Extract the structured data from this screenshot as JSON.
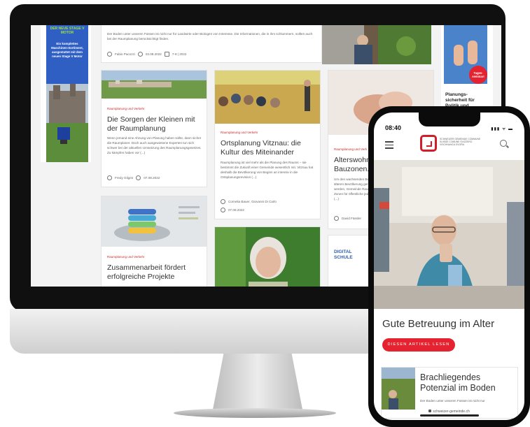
{
  "desktop": {
    "top_article": {
      "text": "Der Boden unter unseren Füssen ist nicht nur für Landwirte oder Biologen von Interesse. Die Informationen, die in ihm schlummern, sollten auch bei der Raumplanung berücksichtigt finden.",
      "author": "Fabio Pacozzi",
      "date": "03.08.2022",
      "issue": "7-8 | 2022"
    },
    "ad_left": {
      "headline": "DER NEUE STAGE V MOTOR",
      "text": "Ein komplettes Maschinen-Sortiment, ausgestattet mit dem neuen Stage V Motor"
    },
    "ad_right": {
      "badge": "Tages-seminar!",
      "text": "Planungs-sicherheit für Politik und"
    },
    "cards": [
      {
        "tag": "Raumplanung und Verkehr",
        "title": "Die Sorgen der Kleinen mit der Raumplanung",
        "body": "Wenn jemand eine Ahnung von Planung haben sollte, dann sicher die Raumplaner. Doch auch ausgewiesene Experten tun sich schwer bei der aktuellen Umsetzung des Raumplanungsgesetzes. Zu kämpfen haben vor (...)",
        "author": "Fredy Gilgen",
        "date": "07.08.2022"
      },
      {
        "tag": "Raumplanung und Verkehr",
        "title": "Ortsplanung Vitznau: die Kultur des Miteinander",
        "body": "Raumplanung ist viel mehr als die Planung des Raums – sie bestimmt die Zukunft einer Gemeinde wesentlich mit. Vitznau hat deshalb die Bevölkerung von Beginn an intensiv in die Ortsplanungsrevision (...)",
        "author": "Cornelia Bauer, Giovanni Di Carlo",
        "date": "07.08.2022"
      },
      {
        "tag": "Raumplanung und Verk",
        "title": "Alterswohnu Bauzonen. D",
        "body": "Um den wachsenden Bedarf an älteren Bevölkerung gerecht zu werden, Gemeinde Raum g Zonen für öffentliche jedem Fall (...)",
        "author": "David Fässler"
      },
      {
        "tag": "Raumplanung und Verkehr",
        "title": "Zusammenarbeit fördert erfolgreiche Projekte"
      },
      {
        "title": "DIGITAL SCHULE"
      }
    ]
  },
  "phone": {
    "time": "08:40",
    "status": "▮▮▮ ᯤ ▬",
    "logo_text": "SCHWEIZER GEMEINDE COMMUNE SUISSE COMUNE SVIZZERO VISCHNANCA SVIZRA",
    "hero_title": "Gute Betreuung im Alter",
    "cta_label": "DIESEN ARTIKEL LESEN",
    "card_title": "Brachliegendes Potenzial im Boden",
    "card_body": "Der Boden unter unseren Füssen ist nicht nur",
    "url": "schweizer-gemeinde.ch"
  },
  "colors": {
    "accent": "#e42230",
    "tag_red": "#d02a2a"
  }
}
